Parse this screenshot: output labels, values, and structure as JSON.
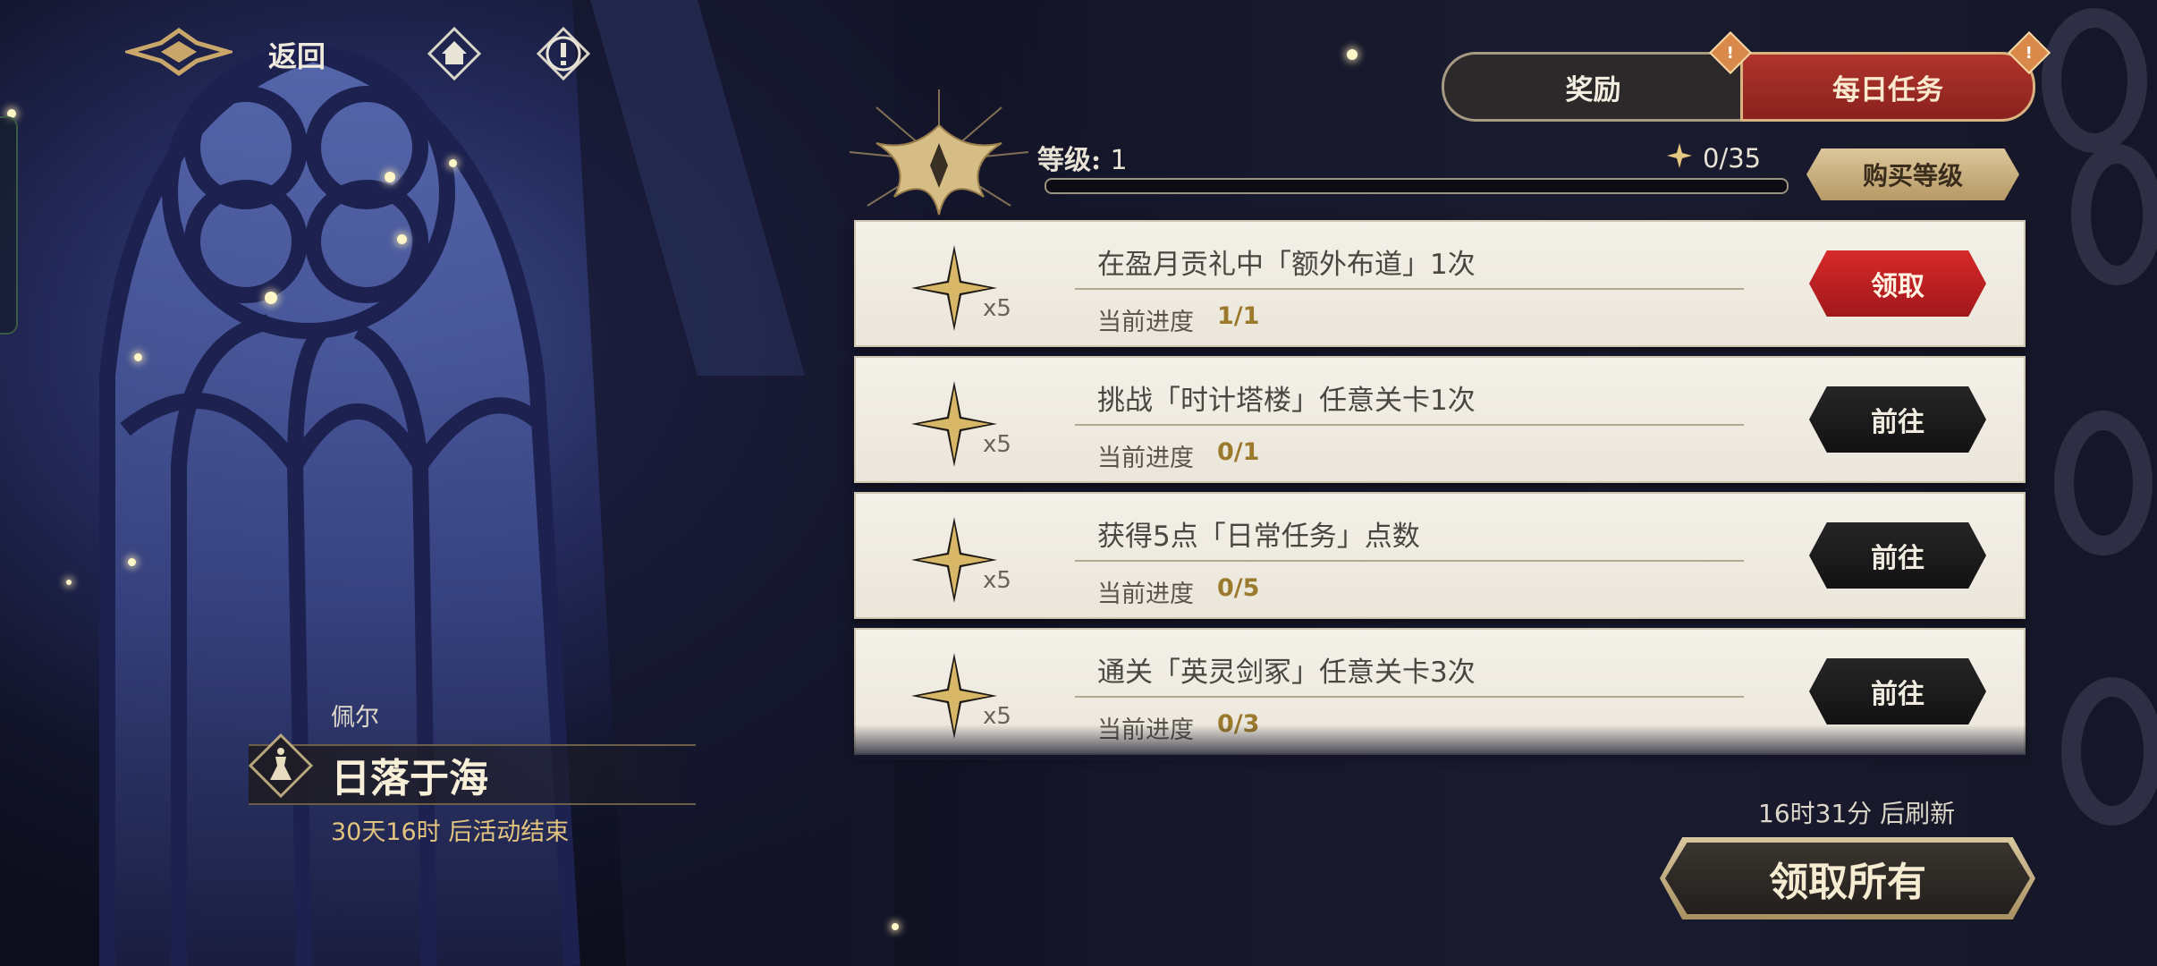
{
  "nav": {
    "back_label": "返回",
    "icons": [
      "logo-emblem-icon",
      "home-icon",
      "alert-icon"
    ]
  },
  "tabs": [
    {
      "label": "奖励",
      "active": false,
      "badge": "!"
    },
    {
      "label": "每日任务",
      "active": true,
      "badge": "!"
    }
  ],
  "level": {
    "label": "等级:",
    "value": "1",
    "xp_text": "0/35",
    "xp_progress": 0,
    "buy_label": "购买等级"
  },
  "quests": [
    {
      "title": "在盈月贡礼中「额外布道」1次",
      "reward_count": "x5",
      "progress_label": "当前进度",
      "progress": "1/1",
      "button": "领取",
      "button_type": "claim"
    },
    {
      "title": "挑战「时计塔楼」任意关卡1次",
      "reward_count": "x5",
      "progress_label": "当前进度",
      "progress": "0/1",
      "button": "前往",
      "button_type": "goto"
    },
    {
      "title": "获得5点「日常任务」点数",
      "reward_count": "x5",
      "progress_label": "当前进度",
      "progress": "0/5",
      "button": "前往",
      "button_type": "goto"
    },
    {
      "title": "通关「英灵剑冢」任意关卡3次",
      "reward_count": "x5",
      "progress_label": "当前进度",
      "progress": "0/3",
      "button": "前往",
      "button_type": "goto"
    }
  ],
  "character": {
    "name": "佩尔",
    "costume": "日落于海",
    "event_end": "30天16时 后活动结束"
  },
  "refresh_text": "16时31分 后刷新",
  "claim_all_label": "领取所有",
  "colors": {
    "accent_red": "#a2171b",
    "gold": "#d2b87c",
    "progress_gold": "#9b7a2e"
  }
}
